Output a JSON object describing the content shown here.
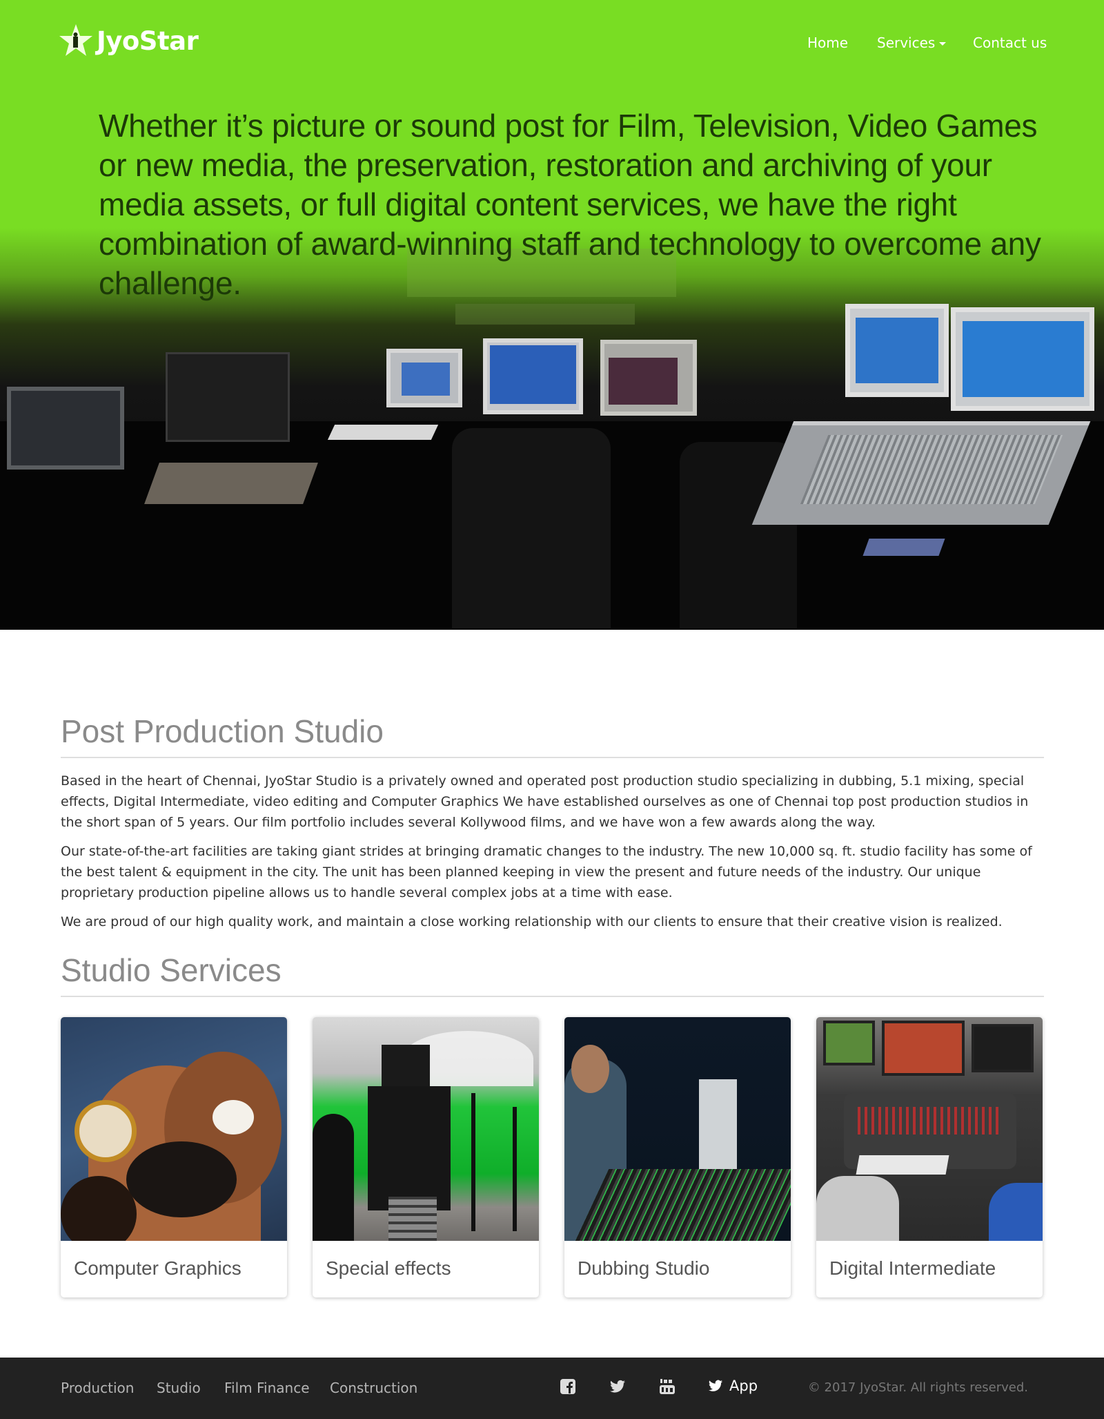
{
  "brand": {
    "name": "JyoStar",
    "icon": "star-logo-icon"
  },
  "nav": {
    "home": "Home",
    "services": "Services",
    "contact": "Contact us"
  },
  "hero": {
    "text": "Whether it’s picture or sound post for Film, Television, Video Games or new media, the preservation, restoration and archiving of your media assets, or full digital content services, we have the right combination of award-winning staff and technology to overcome any challenge."
  },
  "about": {
    "title": "Post Production Studio",
    "paragraphs": [
      "Based in the heart of Chennai, JyoStar Studio is a privately owned and operated post production studio specializing in dubbing, 5.1 mixing, special effects, Digital Intermediate, video editing and Computer Graphics We have established ourselves as one of Chennai top post production studios in the short span of 5 years. Our film portfolio includes several Kollywood films, and we have won a few awards along the way.",
      "Our state-of-the-art facilities are taking giant strides at bringing dramatic changes to the industry. The new 10,000 sq. ft. studio facility has some of the best talent & equipment in the city. The unit has been planned keeping in view the present and future needs of the industry. Our unique proprietary production pipeline allows us to handle several complex jobs at a time with ease.",
      "We are proud of our high quality work, and maintain a close working relationship with our clients to ensure that their creative vision is realized."
    ]
  },
  "services": {
    "title": "Studio Services",
    "items": [
      {
        "label": "Computer Graphics"
      },
      {
        "label": "Special effects"
      },
      {
        "label": "Dubbing Studio"
      },
      {
        "label": "Digital Intermediate"
      }
    ]
  },
  "footer": {
    "links": [
      "Production",
      "Studio",
      "Film Finance",
      "Construction"
    ],
    "social": [
      "facebook-icon",
      "twitter-icon",
      "youtube-icon"
    ],
    "app_label": "App",
    "copyright": "© 2017 JyoStar. All rights reserved."
  },
  "colors": {
    "brand_green": "#79dd23",
    "footer_bg": "#222222",
    "hero_text": "#1c3a08"
  }
}
